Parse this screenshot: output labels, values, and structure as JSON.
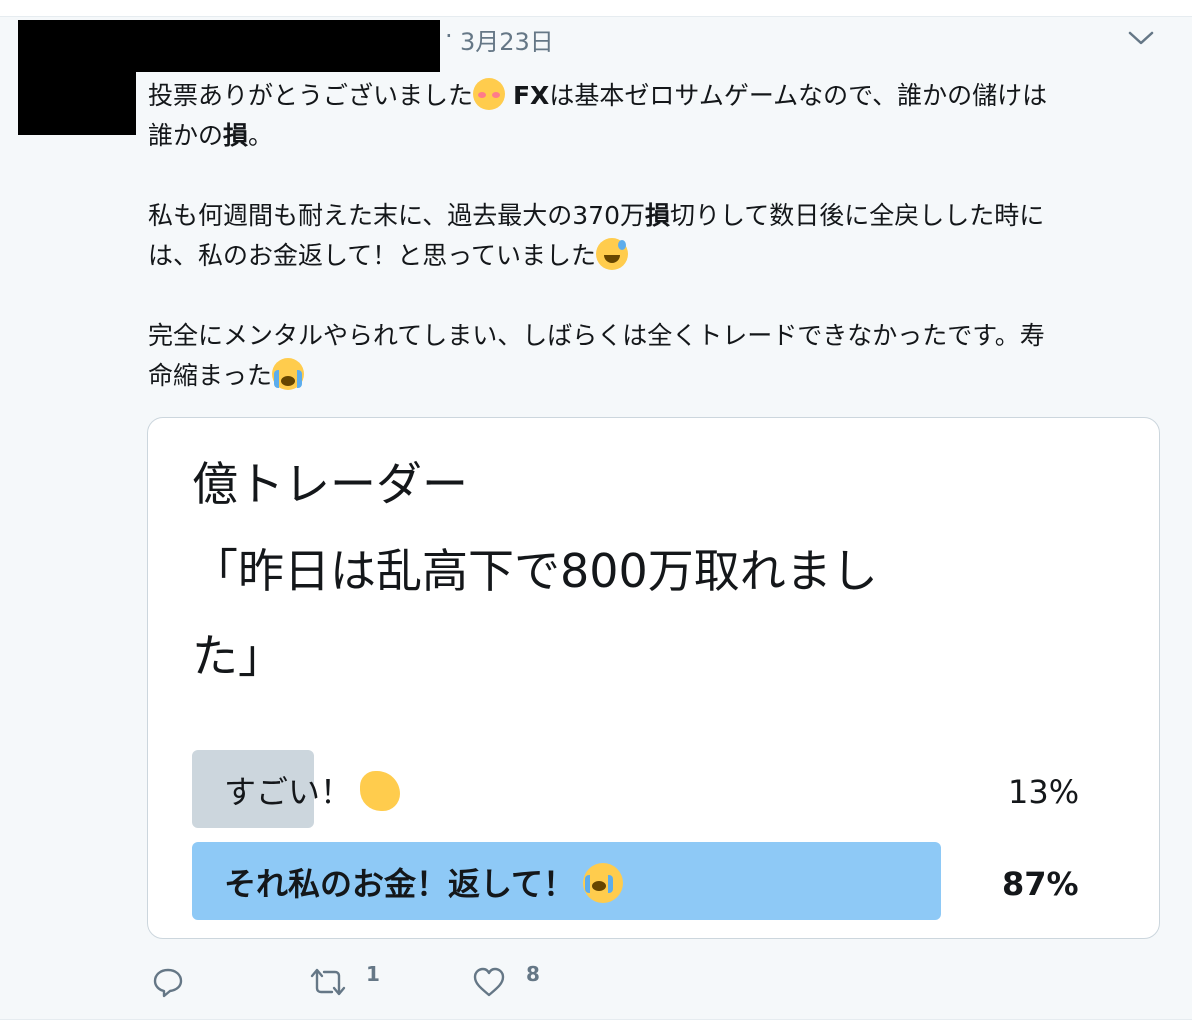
{
  "tweet": {
    "separator": "·",
    "date": "3月23日",
    "text_lines": [
      {
        "pre": "投票ありがとうございました",
        "emoji": "smiling-blush",
        "bold": "FX",
        "post": "は基本ゼロサムゲームなので、誰かの儲けは"
      },
      {
        "pre": "誰かの",
        "bold": "損",
        "post": "。"
      },
      {
        "pre": "私も何週間も耐えた末に、過去最大の370万",
        "bold": "損",
        "post": "切りして数日後に全戻しした時に"
      },
      {
        "pre": "は、私のお金返して！と思っていました",
        "emoji": "sweat-smile"
      },
      {
        "pre": "完全にメンタルやられてしまい、しばらくは全くトレードできなかったです。寿"
      },
      {
        "pre": "命縮まった",
        "emoji": "loudly-crying"
      }
    ]
  },
  "poll": {
    "question_lines": [
      "億トレーダー",
      "「昨日は乱高下で800万取れまし",
      "た」"
    ],
    "options": [
      {
        "label": "すごい！",
        "emoji": "clapping-hands",
        "percent": "13%",
        "share": 0.13,
        "winner": false
      },
      {
        "label": "それ私のお金！返して！",
        "emoji": "loudly-crying",
        "percent": "87%",
        "share": 0.87,
        "winner": true
      }
    ]
  },
  "actions": {
    "reply_count": "",
    "retweet_count": "1",
    "like_count": "8"
  },
  "colors": {
    "background": "#f5f8fa",
    "poll_loser_bar": "#ccd6dd",
    "poll_winner_bar": "#8ec9f6",
    "muted_text": "#657786"
  },
  "icons": [
    "chevron-down-icon",
    "reply-icon",
    "retweet-icon",
    "like-icon"
  ]
}
